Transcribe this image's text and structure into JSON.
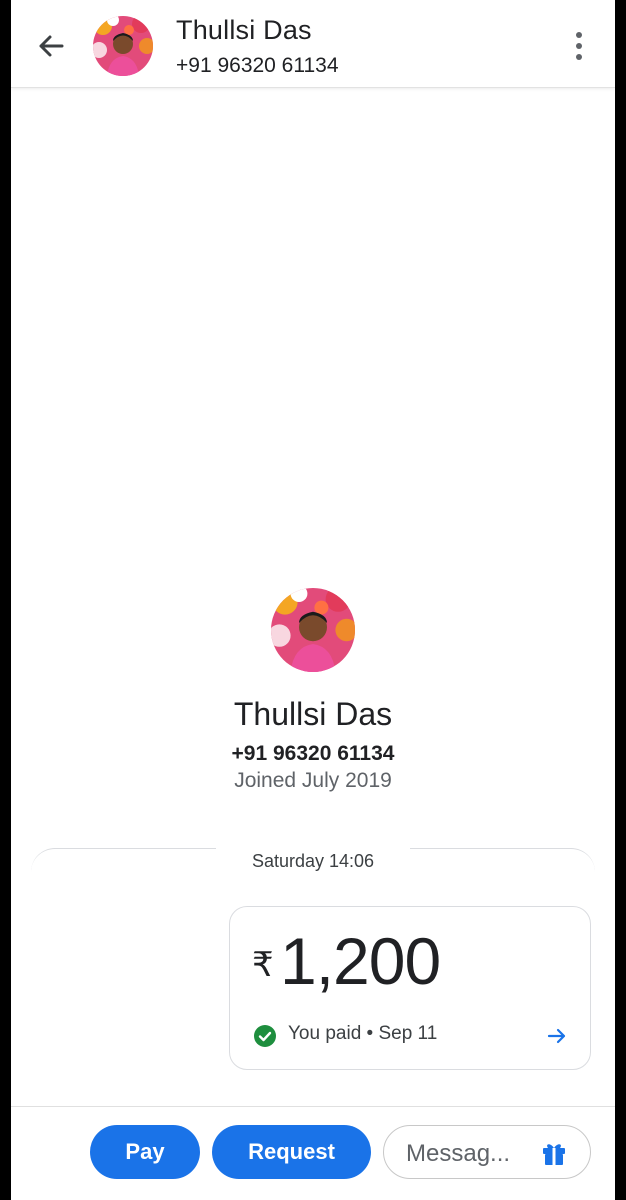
{
  "header": {
    "name": "Thullsi Das",
    "phone": "+91 96320 61134",
    "avatar_icon": "contact-photo",
    "back_icon": "arrow-back-icon",
    "menu_icon": "more-vert-icon"
  },
  "profile": {
    "name": "Thullsi Das",
    "phone": "+91 96320 61134",
    "joined": "Joined July 2019"
  },
  "conversation": {
    "date_label": "Saturday 14:06",
    "payment": {
      "currency_symbol": "₹",
      "amount": "1,200",
      "status": "You paid • Sep 11",
      "status_color": "#1e8e3e",
      "accent_color": "#1a73e8"
    }
  },
  "actions": {
    "pay_label": "Pay",
    "request_label": "Request",
    "message_placeholder": "Messag...",
    "gift_icon": "gift-icon",
    "button_color": "#1a73e8"
  }
}
